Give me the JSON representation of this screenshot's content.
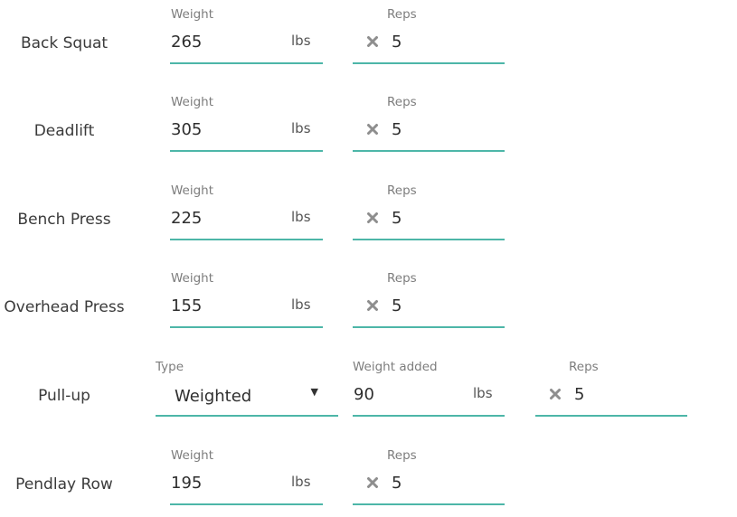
{
  "exercises": [
    {
      "name": "Back Squat",
      "weight_label": "Weight",
      "weight": "265",
      "unit": "lbs",
      "reps_label": "Reps",
      "reps": "5"
    },
    {
      "name": "Deadlift",
      "weight_label": "Weight",
      "weight": "305",
      "unit": "lbs",
      "reps_label": "Reps",
      "reps": "5"
    },
    {
      "name": "Bench Press",
      "weight_label": "Weight",
      "weight": "225",
      "unit": "lbs",
      "reps_label": "Reps",
      "reps": "5"
    },
    {
      "name": "Overhead Press",
      "weight_label": "Weight",
      "weight": "155",
      "unit": "lbs",
      "reps_label": "Reps",
      "reps": "5"
    },
    {
      "name": "Pull-up",
      "type_label": "Type",
      "type": "Weighted",
      "weight_label": "Weight added",
      "weight": "90",
      "unit": "lbs",
      "reps_label": "Reps",
      "reps": "5"
    },
    {
      "name": "Pendlay Row",
      "weight_label": "Weight",
      "weight": "195",
      "unit": "lbs",
      "reps_label": "Reps",
      "reps": "5"
    }
  ],
  "icons": {
    "reps_multiplier": "close-x-icon",
    "type_dropdown": "caret-down-icon"
  },
  "colors": {
    "accent_underline": "#4db6a8",
    "label": "#7d7d7d",
    "icon": "#8e8e8e"
  }
}
